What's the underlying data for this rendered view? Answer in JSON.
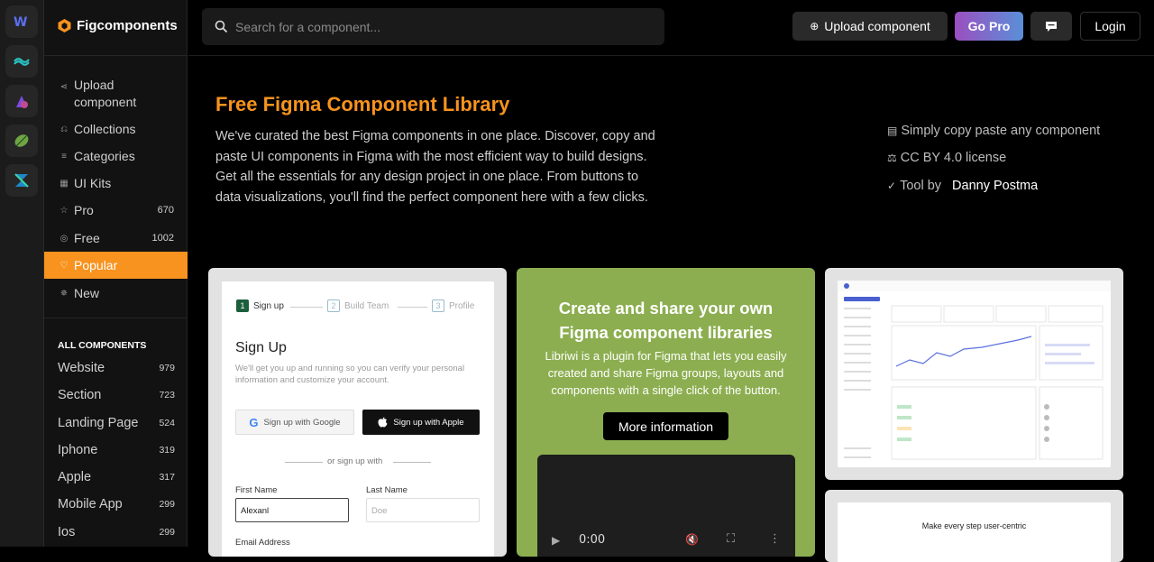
{
  "app": {
    "name": "Figcomponents"
  },
  "rail": {
    "items": [
      "webflow-icon",
      "tailwind-icon",
      "shape-icon",
      "leaf-icon",
      "hourglass-icon"
    ]
  },
  "sidebar": {
    "nav": [
      {
        "label": "Upload component",
        "icon": "upload-icon"
      },
      {
        "label": "Collections",
        "icon": "collections-icon"
      },
      {
        "label": "Categories",
        "icon": "categories-icon"
      },
      {
        "label": "UI Kits",
        "icon": "kits-icon"
      },
      {
        "label": "Pro",
        "count": "670",
        "icon": "star-icon"
      },
      {
        "label": "Free",
        "count": "1002",
        "icon": "free-icon"
      },
      {
        "label": "Popular",
        "icon": "heart-icon"
      },
      {
        "label": "New",
        "icon": "sparkle-icon"
      }
    ],
    "section_title": "ALL COMPONENTS",
    "categories": [
      {
        "label": "Website",
        "count": "979"
      },
      {
        "label": "Section",
        "count": "723"
      },
      {
        "label": "Landing Page",
        "count": "524"
      },
      {
        "label": "Iphone",
        "count": "319"
      },
      {
        "label": "Apple",
        "count": "317"
      },
      {
        "label": "Mobile App",
        "count": "299"
      },
      {
        "label": "Ios",
        "count": "299"
      }
    ]
  },
  "topbar": {
    "search_placeholder": "Search for a component...",
    "upload_label": "Upload component",
    "gopro_label": "Go Pro",
    "login_label": "Login"
  },
  "hero": {
    "title": "Free Figma Component Library",
    "description": "We've curated the best Figma components in one place. Discover, copy and paste UI components in Figma with the most efficient way to build designs. Get all the essentials for any design project in one place. From buttons to data visualizations, you'll find the perfect component here with a few clicks.",
    "features": [
      {
        "text": "Simply copy paste any component"
      },
      {
        "text": "CC BY 4.0 license"
      },
      {
        "text": "Tool by ",
        "strong": "Danny Postma"
      }
    ]
  },
  "signup_card": {
    "steps": [
      {
        "num": "1",
        "label": "Sign up"
      },
      {
        "num": "2",
        "label": "Build Team"
      },
      {
        "num": "3",
        "label": "Profile"
      }
    ],
    "title": "Sign Up",
    "subtitle": "We'll get you up and running so you can verify your personal information and customize your account.",
    "google_label": "Sign up with Google",
    "apple_label": "Sign up with Apple",
    "divider": "or sign up with",
    "first_name_label": "First Name",
    "first_name_value": "Alexanl",
    "last_name_label": "Last Name",
    "last_name_placeholder": "Doe",
    "email_label": "Email Address"
  },
  "promo_card": {
    "title": "Create and share your own Figma component libraries",
    "text": "Libriwi is a plugin for Figma that lets you easily created and share Figma groups, layouts and components with a single click of the button.",
    "button": "More information",
    "video_time": "0:00"
  },
  "preview_card_bottom": {
    "title": "Make every step user-centric"
  },
  "colors": {
    "accent": "#f7931e",
    "gopro": "#7b5cc8",
    "promo_bg": "#8cae50"
  }
}
